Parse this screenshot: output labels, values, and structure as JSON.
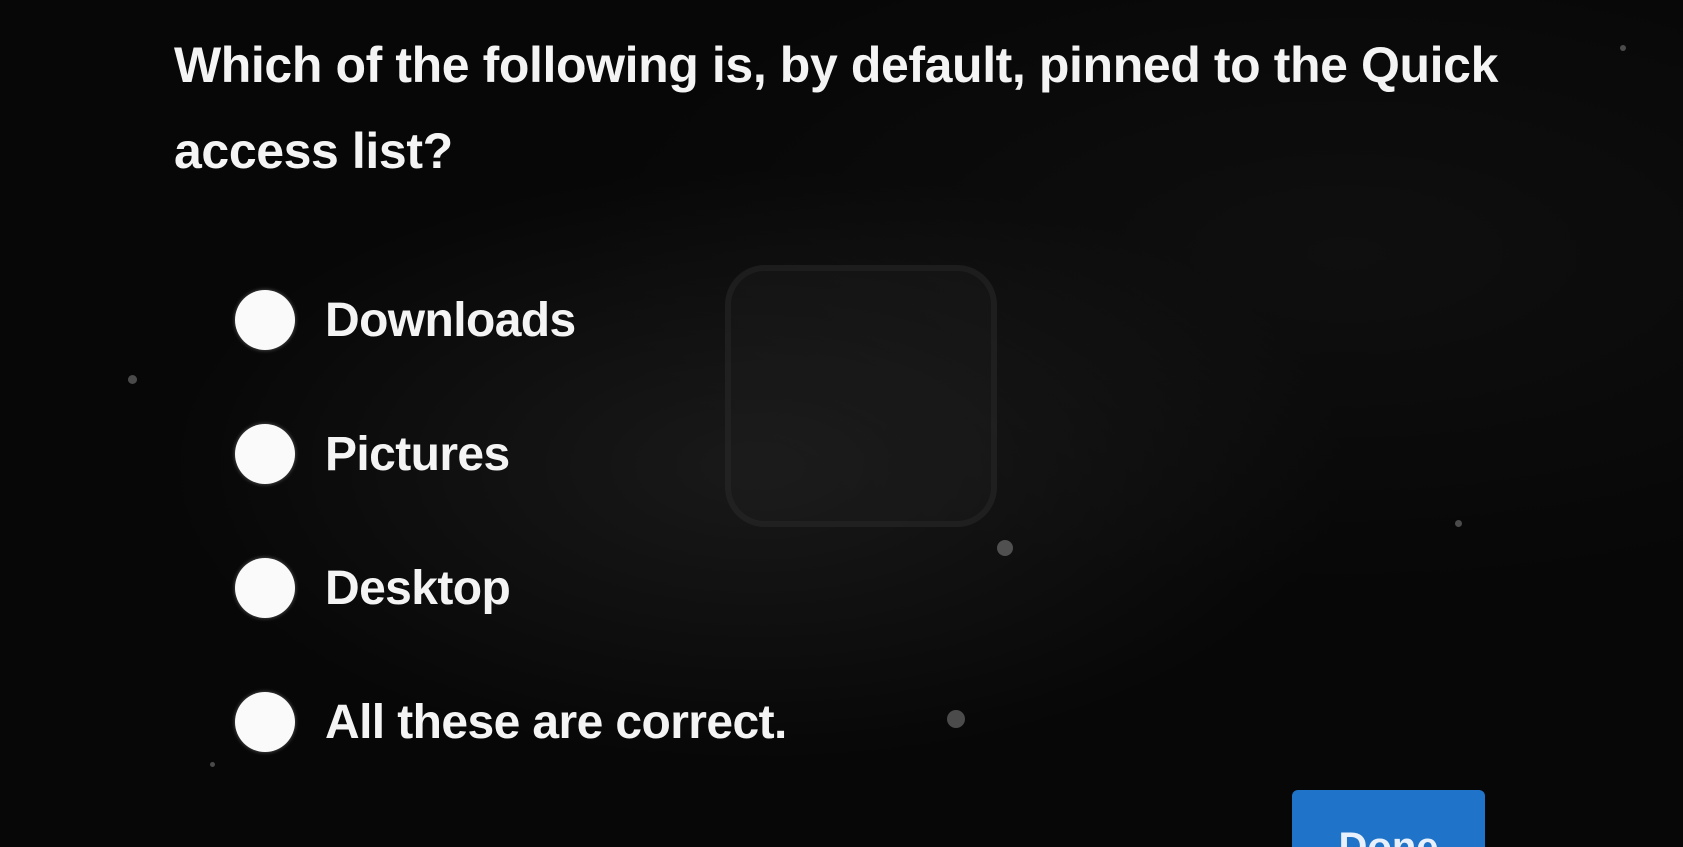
{
  "quiz": {
    "question": "Which of the following is, by default, pinned to the Quick access list?",
    "options": [
      {
        "label": "Downloads"
      },
      {
        "label": "Pictures"
      },
      {
        "label": "Desktop"
      },
      {
        "label": "All these are correct."
      }
    ],
    "done_label": "Done"
  },
  "colors": {
    "background": "#070707",
    "text": "#f4f4f4",
    "radio": "#fafafa",
    "done_button": "#1f73c9"
  }
}
